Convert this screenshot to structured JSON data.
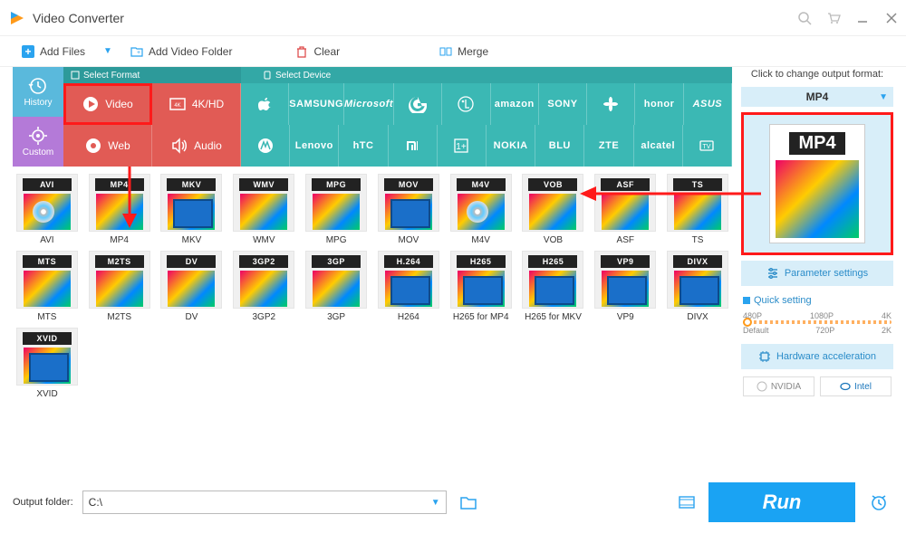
{
  "app": {
    "title": "Video Converter"
  },
  "titlebar_icons": [
    "search",
    "cart",
    "minimize",
    "close"
  ],
  "toolbar": {
    "add_files": "Add Files",
    "add_folder": "Add Video Folder",
    "clear": "Clear",
    "merge": "Merge"
  },
  "side": {
    "history": "History",
    "custom": "Custom"
  },
  "cat_headers": {
    "format": "Select Format",
    "device": "Select Device"
  },
  "cat_types": {
    "row1": [
      {
        "label": "Video",
        "selected": true
      },
      {
        "label": "4K/HD"
      }
    ],
    "row2": [
      {
        "label": "Web"
      },
      {
        "label": "Audio"
      }
    ]
  },
  "brands": {
    "row1": [
      "Apple",
      "SAMSUNG",
      "Microsoft",
      "Google",
      "LG",
      "amazon",
      "SONY",
      "HUAWEI",
      "honor",
      "ASUS"
    ],
    "row2": [
      "Motorola",
      "Lenovo",
      "hTC",
      "Xiaomi",
      "OnePlus",
      "NOKIA",
      "BLU",
      "ZTE",
      "alcatel",
      "TV"
    ]
  },
  "formats": [
    [
      "AVI",
      "MP4",
      "MKV",
      "WMV",
      "MPG",
      "MOV",
      "M4V",
      "VOB",
      "ASF",
      "TS"
    ],
    [
      "MTS",
      "M2TS",
      "DV",
      "3GP2",
      "3GP",
      "H264",
      "H265 for MP4",
      "H265 for MKV",
      "VP9",
      "DIVX"
    ],
    [
      "XVID"
    ]
  ],
  "format_badges": [
    [
      "AVI",
      "MP4",
      "MKV",
      "WMV",
      "MPG",
      "MOV",
      "M4V",
      "VOB",
      "ASF",
      "TS"
    ],
    [
      "MTS",
      "M2TS",
      "DV",
      "3GP2",
      "3GP",
      "H.264",
      "H265",
      "H265",
      "VP9",
      "DIVX"
    ],
    [
      "XVID"
    ]
  ],
  "right": {
    "hint": "Click to change output format:",
    "selected_format": "MP4",
    "param_settings": "Parameter settings",
    "quick_setting": "Quick setting",
    "quality_marks_top": [
      "480P",
      "1080P",
      "4K"
    ],
    "quality_marks_bot": [
      "Default",
      "720P",
      "2K"
    ],
    "hw_accel": "Hardware acceleration",
    "nvidia": "NVIDIA",
    "intel": "Intel"
  },
  "bottom": {
    "output_label": "Output folder:",
    "output_path": "C:\\",
    "run": "Run"
  }
}
